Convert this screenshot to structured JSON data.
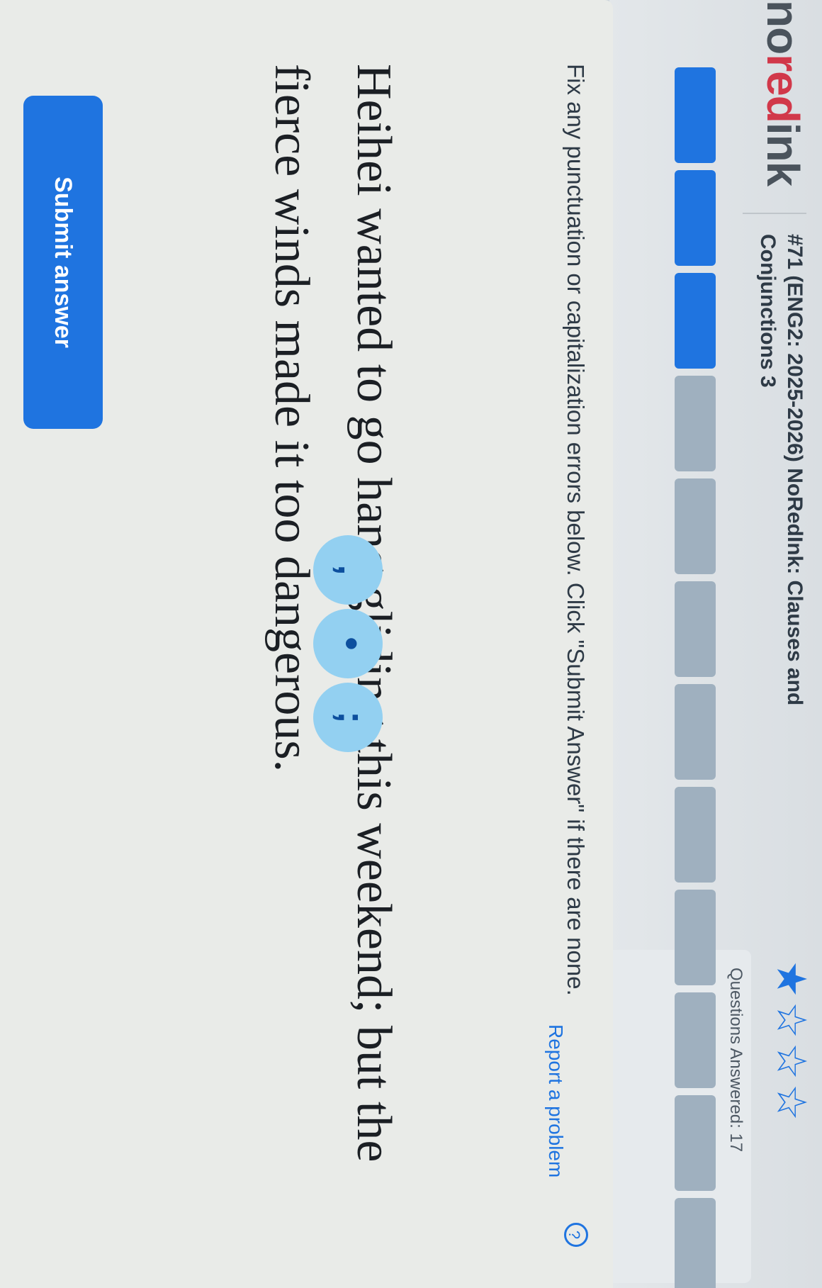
{
  "header": {
    "logo_prefix": "no",
    "logo_accent": "red",
    "logo_suffix": "ink",
    "assignment_title": "#71 (ENG2: 2025-2026) NoRedInk: Clauses and Conjunctions 3",
    "stars": [
      "star-filled-icon",
      "star-empty-icon",
      "star-empty-icon",
      "star-empty-icon"
    ],
    "questions_answered": "Questions Answered: 17"
  },
  "progress": {
    "filled_segments": 3,
    "total_segments": 12
  },
  "question": {
    "help_glyph": "?",
    "instructions": "Fix any punctuation or capitalization errors below. Click \"Submit Answer\" if there are none.",
    "sentence": "Heihei wanted to go hang gliding this weekend; but the fierce winds made it too dangerous.",
    "punctuation_options": [
      ",",
      "•",
      ";"
    ]
  },
  "actions": {
    "submit_label": "Submit answer",
    "report_label": "Report a problem"
  },
  "colors": {
    "brand_blue": "#1f74e0",
    "brand_red": "#d1384a",
    "chip_bg": "#93d0f1"
  }
}
